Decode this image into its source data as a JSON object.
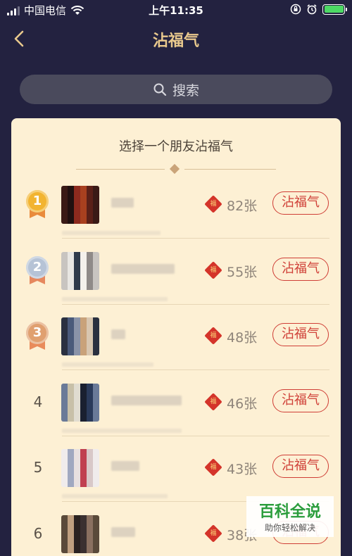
{
  "status_bar": {
    "carrier": "中国电信",
    "time": "上午11:35",
    "battery_color": "#4cd964"
  },
  "nav": {
    "title": "沾福气",
    "back_icon": "chevron-left-icon"
  },
  "search": {
    "label": "搜索",
    "icon": "search-icon"
  },
  "card": {
    "title": "选择一个朋友沾福气"
  },
  "rankings": [
    {
      "rank": "1",
      "medal": "gold",
      "count": "82张",
      "button": "沾福气"
    },
    {
      "rank": "2",
      "medal": "silver",
      "count": "55张",
      "button": "沾福气"
    },
    {
      "rank": "3",
      "medal": "bronze",
      "count": "48张",
      "button": "沾福气"
    },
    {
      "rank": "4",
      "medal": "",
      "count": "46张",
      "button": "沾福气"
    },
    {
      "rank": "5",
      "medal": "",
      "count": "43张",
      "button": "沾福气"
    },
    {
      "rank": "6",
      "medal": "",
      "count": "38张",
      "button": "沾福气"
    }
  ],
  "fu_icon_char": "福",
  "watermark": {
    "title": "百科全说",
    "subtitle": "助你轻松解决"
  },
  "colors": {
    "background": "#232240",
    "title_gold": "#e9c98d",
    "card": "#fdf0d4",
    "accent_red": "#cf3e36"
  }
}
